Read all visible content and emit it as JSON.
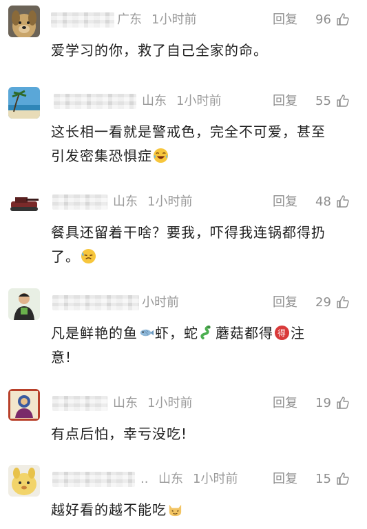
{
  "comments": [
    {
      "avatar": "dog-avatar",
      "location": "广东",
      "time": "1小时前",
      "reply_label": "回复",
      "likes": "96",
      "text": [
        "爱学习的你，救了自己全家的命。"
      ]
    },
    {
      "avatar": "beach-avatar",
      "location": "山东",
      "time": "1小时前",
      "reply_label": "回复",
      "likes": "55",
      "text": [
        "这长相一看就是警戒色，完全不可爱，甚至",
        "引发密集恐惧症"
      ],
      "emoji": "laugh-cry-emoji"
    },
    {
      "avatar": "tank-avatar",
      "location": "山东",
      "time": "1小时前",
      "reply_label": "回复",
      "likes": "48",
      "text": [
        "餐具还留着干啥？要我，吓得我连锅都得扔",
        "了。"
      ],
      "emoji": "sweat-emoji"
    },
    {
      "avatar": "person-avatar",
      "time_partial": "小时前",
      "reply_label": "回复",
      "likes": "29",
      "text": [
        "凡是鲜艳的鱼",
        "虾，蛇",
        "蘑菇都得",
        "注",
        "意!"
      ],
      "emoji_fish": "fish-emoji",
      "emoji_snake": "snake-emoji",
      "emoji_de": "de-badge-emoji"
    },
    {
      "avatar": "deity-avatar",
      "location": "山东",
      "time": "1小时前",
      "reply_label": "回复",
      "likes": "19",
      "text": [
        "有点后怕，幸亏没吃!"
      ]
    },
    {
      "avatar": "plush-avatar",
      "ellipsis": "..",
      "location": "山东",
      "time": "1小时前",
      "reply_label": "回复",
      "likes": "15",
      "text": [
        "越好看的越不能吃"
      ],
      "emoji": "cat-emoji"
    }
  ]
}
